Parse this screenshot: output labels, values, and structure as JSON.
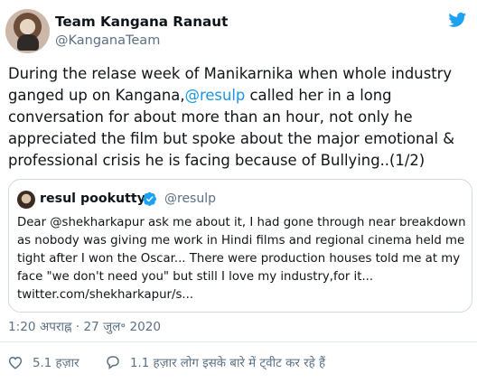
{
  "tweet": {
    "author_name": "Team Kangana Ranaut",
    "author_handle": "@KanganaTeam",
    "text_before_mention": "During the relase week of Manikarnika when whole industry ganged up on Kangana,",
    "mention": "@resulp",
    "text_after_mention": " called her in a long conversation for about more than an hour, not only he appreciated the film but spoke about the major emotional & professional crisis he is facing because of Bullying..(1/2)",
    "timestamp": "1:20 अपराह्न · 27 जुल॰ 2020",
    "icons": {
      "platform": "twitter-bird-icon",
      "like": "heart-icon",
      "reply": "reply-icon"
    },
    "colors": {
      "accent": "#1b95e0",
      "muted": "#5b7083"
    }
  },
  "quoted": {
    "author_name": "resul pookutty",
    "author_handle": "@resulp",
    "text": "Dear @shekharkapur ask me about it, I had gone through near breakdown as nobody was giving me work in Hindi films and regional cinema held me tight after I won the Oscar... There were production houses told me at my face \"we don't need you\" but still I love my industry,for it... twitter.com/shekharkapur/s..."
  },
  "actions": {
    "likes": "5.1 हज़ार",
    "discussing": "1.1 हज़ार लोग इसके बारे में ट्वीट कर रहे हैं"
  }
}
